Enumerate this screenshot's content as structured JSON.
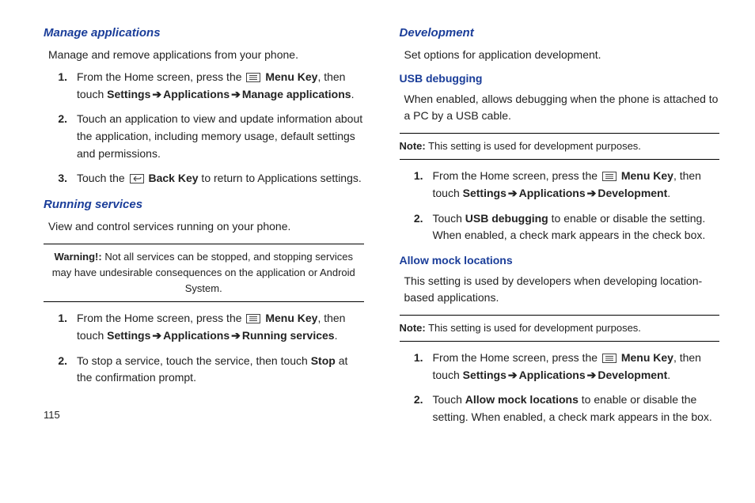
{
  "pageNumber": "115",
  "arrow": "➔",
  "left": {
    "sec1": {
      "title": "Manage applications",
      "desc": "Manage and remove applications from your phone.",
      "steps": {
        "s1a": "From the Home screen, press the ",
        "s1b": "Menu Key",
        "s1c": ", then touch ",
        "s1d": "Settings",
        "s1e": "Applications",
        "s1f": "Manage applications",
        "s1g": ".",
        "s2": "Touch an application to view and update information about the application, including memory usage, default settings and permissions.",
        "s3a": "Touch the ",
        "s3b": "Back Key",
        "s3c": " to return to Applications settings."
      }
    },
    "sec2": {
      "title": "Running services",
      "desc": "View and control services running on your phone.",
      "warnLabel": "Warning!:",
      "warnText": " Not all services can be stopped, and stopping services may have undesirable consequences on the application or Android System.",
      "steps": {
        "s1a": "From the Home screen, press the ",
        "s1b": "Menu Key",
        "s1c": ", then touch ",
        "s1d": "Settings",
        "s1e": "Applications",
        "s1f": "Running services",
        "s1g": ".",
        "s2a": "To stop a service, touch the service, then touch ",
        "s2b": "Stop",
        "s2c": " at the confirmation prompt."
      }
    }
  },
  "right": {
    "sec1": {
      "title": "Development",
      "desc": "Set options for application development."
    },
    "sec2": {
      "title": "USB debugging",
      "desc": "When enabled, allows debugging when the phone is attached to a PC by a USB cable.",
      "noteLabel": "Note:",
      "noteText": " This setting is used for development purposes.",
      "steps": {
        "s1a": "From the Home screen, press the ",
        "s1b": "Menu Key",
        "s1c": ", then touch ",
        "s1d": "Settings",
        "s1e": "Applications",
        "s1f": "Development",
        "s1g": ".",
        "s2a": "Touch ",
        "s2b": "USB debugging ",
        "s2c": " to enable or disable the setting. When enabled, a check mark appears in the check box."
      }
    },
    "sec3": {
      "title": "Allow mock locations",
      "desc": "This setting is used by developers when developing location-based applications.",
      "noteLabel": "Note:",
      "noteText": " This setting is used for development purposes.",
      "steps": {
        "s1a": "From the Home screen, press the ",
        "s1b": "Menu Key",
        "s1c": ", then touch ",
        "s1d": "Settings",
        "s1e": "Applications",
        "s1f": "Development",
        "s1g": ".",
        "s2a": "Touch ",
        "s2b": "Allow mock locations",
        "s2c": " to enable or disable the setting. When enabled, a check mark appears in the box."
      }
    }
  }
}
